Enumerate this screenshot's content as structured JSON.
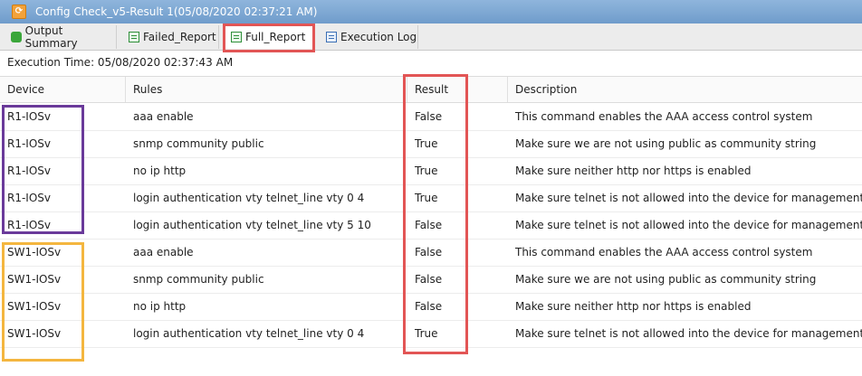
{
  "window": {
    "title": "Config Check_v5-Result 1(05/08/2020 02:37:21 AM)"
  },
  "tabs": [
    {
      "label": "Output Summary",
      "icon": "database-icon"
    },
    {
      "label": "Failed_Report",
      "icon": "report-icon"
    },
    {
      "label": "Full_Report",
      "icon": "report-icon",
      "active": true
    },
    {
      "label": "Execution Log",
      "icon": "log-icon"
    }
  ],
  "execution_time": "Execution Time: 05/08/2020 02:37:43 AM",
  "table": {
    "columns": [
      "Device",
      "Rules",
      "Result",
      "Description"
    ],
    "rows": [
      {
        "device": "R1-IOSv",
        "rule": "aaa enable",
        "result": "False",
        "description": "This command enables the AAA access control system"
      },
      {
        "device": "R1-IOSv",
        "rule": "snmp community public",
        "result": "True",
        "description": "Make sure we are not using public as community string"
      },
      {
        "device": "R1-IOSv",
        "rule": "no ip http",
        "result": "True",
        "description": "Make sure neither http nor https is enabled"
      },
      {
        "device": "R1-IOSv",
        "rule": "login authentication vty telnet_line vty 0 4",
        "result": "True",
        "description": "Make sure telnet is not allowed into the device for management"
      },
      {
        "device": "R1-IOSv",
        "rule": "login authentication vty telnet_line vty 5 10",
        "result": "False",
        "description": "Make sure telnet is not allowed into the device for management"
      },
      {
        "device": "SW1-IOSv",
        "rule": "aaa enable",
        "result": "False",
        "description": "This command enables the AAA access control system"
      },
      {
        "device": "SW1-IOSv",
        "rule": "snmp community public",
        "result": "False",
        "description": "Make sure we are not using public as community string"
      },
      {
        "device": "SW1-IOSv",
        "rule": "no ip http",
        "result": "False",
        "description": "Make sure neither http nor https is enabled"
      },
      {
        "device": "SW1-IOSv",
        "rule": "login authentication vty telnet_line vty 0 4",
        "result": "True",
        "description": "Make sure telnet is not allowed into the device for management"
      }
    ]
  },
  "colors": {
    "titlebar": "#7aa6d4",
    "highlight_red": "#e25555",
    "highlight_purple": "#6a3a9a",
    "highlight_orange": "#f4b63f"
  }
}
